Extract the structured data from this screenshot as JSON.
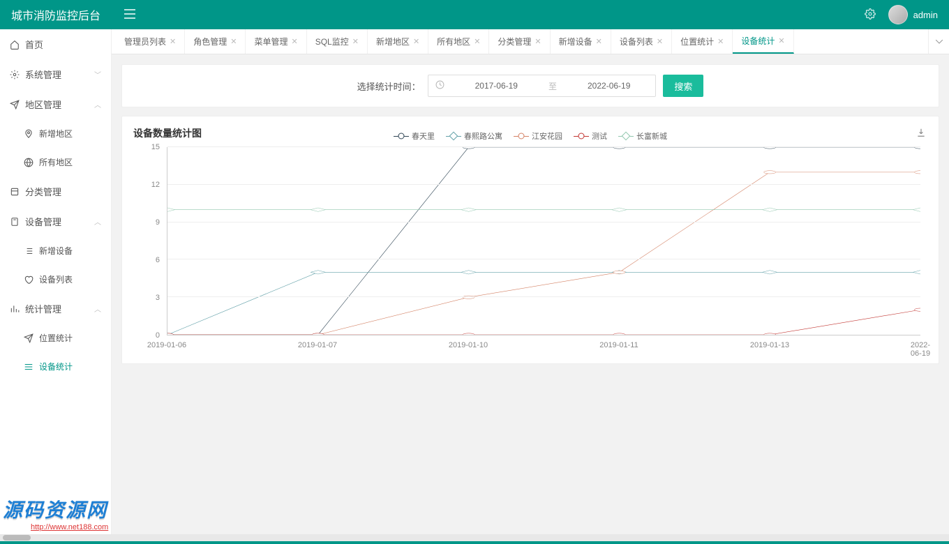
{
  "header": {
    "title": "城市消防监控后台",
    "username": "admin"
  },
  "sidebar": {
    "items": [
      {
        "label": "首页",
        "icon": "home"
      },
      {
        "label": "系统管理",
        "icon": "gear",
        "chev": "down"
      },
      {
        "label": "地区管理",
        "icon": "send",
        "chev": "up"
      },
      {
        "label": "新增地区",
        "icon": "pin",
        "sub": true
      },
      {
        "label": "所有地区",
        "icon": "globe",
        "sub": true
      },
      {
        "label": "分类管理",
        "icon": "layers"
      },
      {
        "label": "设备管理",
        "icon": "device",
        "chev": "up"
      },
      {
        "label": "新增设备",
        "icon": "list",
        "sub": true
      },
      {
        "label": "设备列表",
        "icon": "heart",
        "sub": true
      },
      {
        "label": "统计管理",
        "icon": "bars",
        "chev": "up"
      },
      {
        "label": "位置统计",
        "icon": "send",
        "sub": true
      },
      {
        "label": "设备统计",
        "icon": "menu",
        "sub": true,
        "active": true
      }
    ]
  },
  "tabs": {
    "items": [
      {
        "label": "管理员列表"
      },
      {
        "label": "角色管理"
      },
      {
        "label": "菜单管理"
      },
      {
        "label": "SQL监控"
      },
      {
        "label": "新增地区"
      },
      {
        "label": "所有地区"
      },
      {
        "label": "分类管理"
      },
      {
        "label": "新增设备"
      },
      {
        "label": "设备列表"
      },
      {
        "label": "位置统计"
      },
      {
        "label": "设备统计",
        "active": true
      }
    ]
  },
  "filter": {
    "label": "选择统计时间：",
    "start": "2017-06-19",
    "to": "至",
    "end": "2022-06-19",
    "search": "搜索"
  },
  "chart_data": {
    "type": "line",
    "title": "设备数量统计图",
    "xlabel": "",
    "ylabel": "",
    "ylim": [
      0,
      15
    ],
    "y_ticks": [
      0,
      3,
      6,
      9,
      12,
      15
    ],
    "categories": [
      "2019-01-06",
      "2019-01-07",
      "2019-01-10",
      "2019-01-11",
      "2019-01-13",
      "2022-06-19"
    ],
    "series": [
      {
        "name": "春天里",
        "color": "#2f4554",
        "marker": "circle",
        "values": [
          0,
          0,
          15,
          15,
          15,
          15
        ]
      },
      {
        "name": "春熙路公寓",
        "color": "#61a0a8",
        "marker": "diamond",
        "values": [
          0,
          5,
          5,
          5,
          5,
          5
        ]
      },
      {
        "name": "江安花园",
        "color": "#d48265",
        "marker": "circle",
        "values": [
          0,
          0,
          3,
          5,
          13,
          13
        ]
      },
      {
        "name": "测试",
        "color": "#c23531",
        "marker": "circle",
        "values": [
          0,
          0,
          0,
          0,
          0,
          2
        ]
      },
      {
        "name": "长富新城",
        "color": "#91c7ae",
        "marker": "diamond",
        "values": [
          10,
          10,
          10,
          10,
          10,
          10
        ]
      }
    ]
  },
  "watermark": {
    "text": "源码资源网",
    "url": "http://www.net188.com"
  }
}
